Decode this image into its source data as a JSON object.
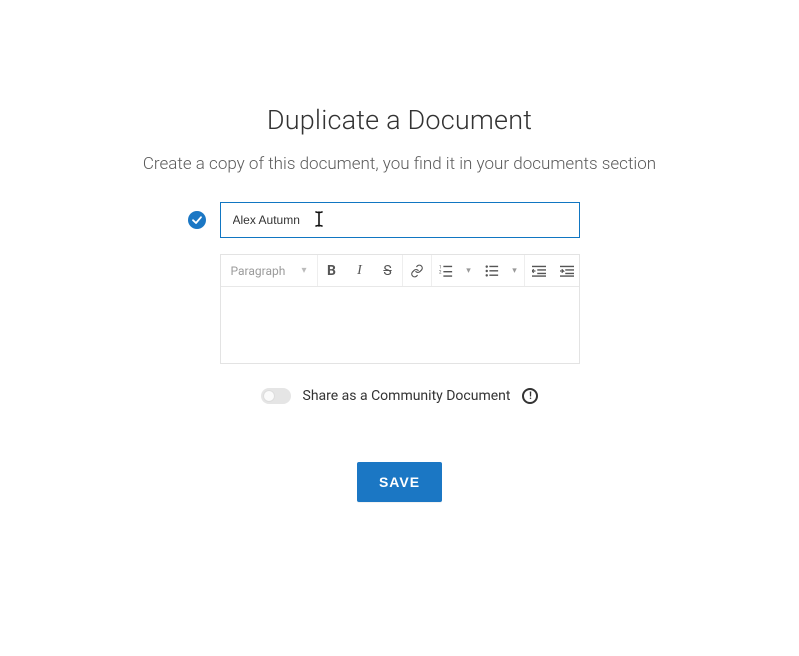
{
  "header": {
    "title": "Duplicate a Document",
    "subtitle": "Create a copy of this document, you find it in your documents section"
  },
  "form": {
    "title_value": "Alex Autumn",
    "title_validated": true
  },
  "editor": {
    "paragraph_label": "Paragraph",
    "body": ""
  },
  "share": {
    "toggle_on": false,
    "label": "Share as a Community Document"
  },
  "actions": {
    "save_label": "SAVE"
  },
  "icons": {
    "check": "check-icon",
    "caret": "caret-down-icon",
    "bold": "bold-icon",
    "italic": "italic-icon",
    "strike": "strikethrough-icon",
    "link": "link-icon",
    "ol": "ordered-list-icon",
    "ul": "unordered-list-icon",
    "outdent": "outdent-icon",
    "indent": "indent-icon",
    "info": "info-icon"
  }
}
